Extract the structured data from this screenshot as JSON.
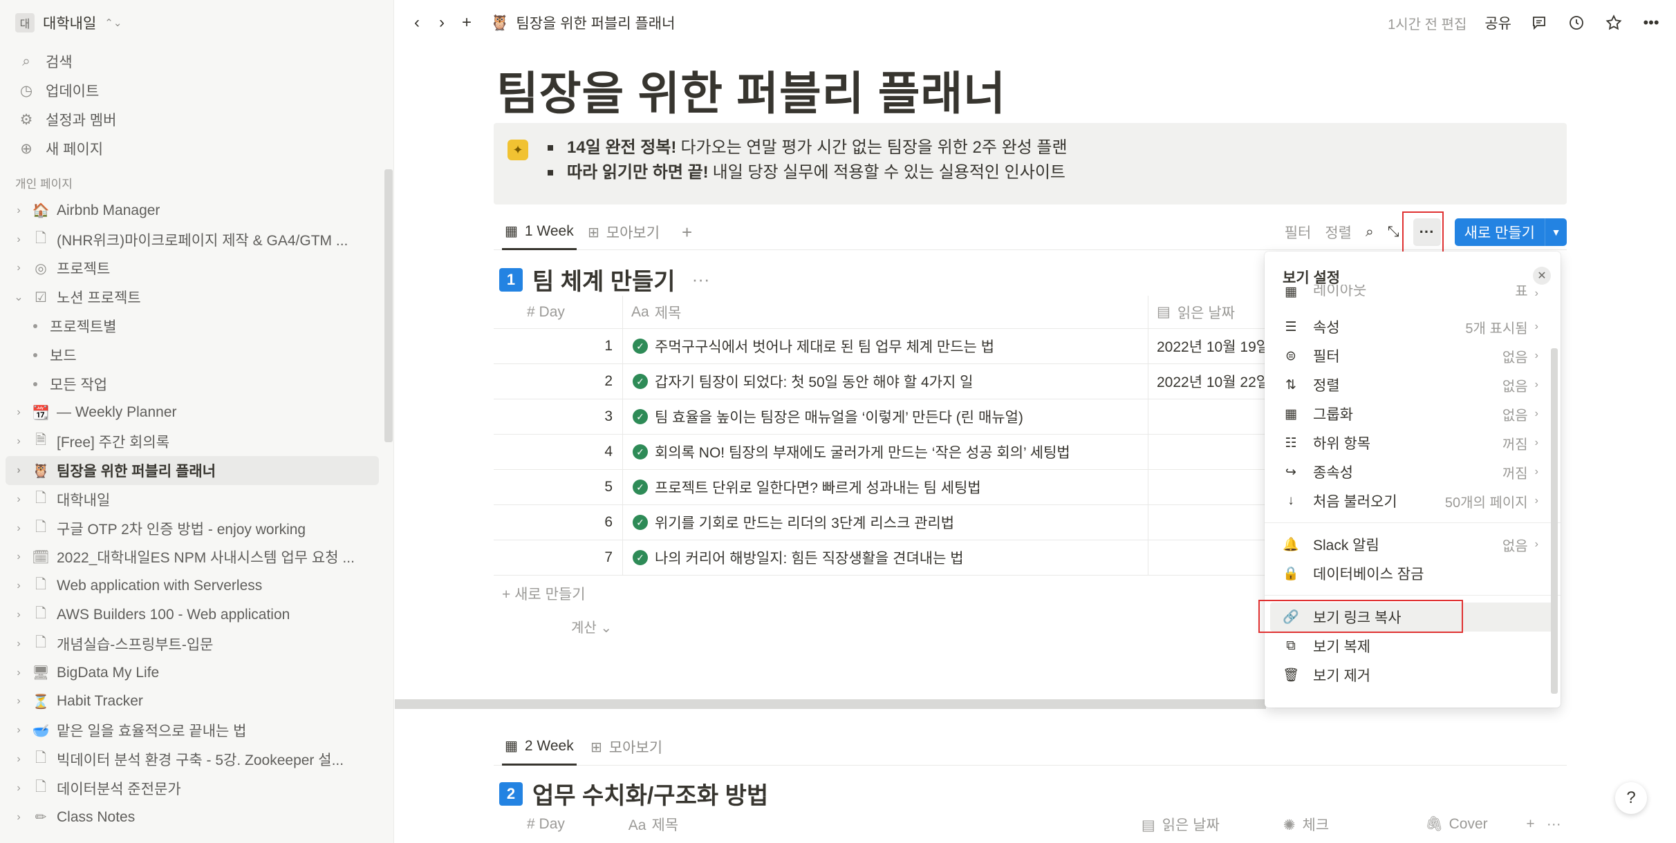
{
  "sidebar": {
    "workspace": {
      "badge": "대",
      "name": "대학내일"
    },
    "top_items": [
      {
        "icon": "search-icon",
        "glyph": "⌕",
        "label": "검색"
      },
      {
        "icon": "clock-icon",
        "glyph": "◷",
        "label": "업데이트"
      },
      {
        "icon": "gear-icon",
        "glyph": "⚙",
        "label": "설정과 멤버"
      },
      {
        "icon": "plus-circle-icon",
        "glyph": "⊕",
        "label": "새 페이지"
      }
    ],
    "section_label": "개인 페이지",
    "tree": [
      {
        "label": "Airbnb Manager",
        "icon": "house-icon",
        "glyph": "🏠"
      },
      {
        "label": "(NHR위크)마이크로페이지 제작 & GA4/GTM ...",
        "icon": "page-icon",
        "glyph": "🗋"
      },
      {
        "label": "프로젝트",
        "icon": "target-icon",
        "glyph": "◎"
      },
      {
        "label": "노션 프로젝트",
        "icon": "checkbox-icon",
        "glyph": "☑"
      },
      {
        "label": "프로젝트별",
        "sub": true
      },
      {
        "label": "보드",
        "sub": true
      },
      {
        "label": "모든 작업",
        "sub": true
      },
      {
        "label": "— Weekly Planner",
        "icon": "calendar-icon",
        "glyph": "📆"
      },
      {
        "label": "[Free] 주간 회의록",
        "icon": "doc-icon",
        "glyph": "🗎"
      },
      {
        "label": "팀장을 위한 퍼블리 플래너",
        "icon": "owl-icon",
        "glyph": "🦉",
        "active": true
      },
      {
        "label": "대학내일",
        "icon": "page-icon",
        "glyph": "🗋"
      },
      {
        "label": "구글 OTP 2차 인증 방법 - enjoy working",
        "icon": "page-icon",
        "glyph": "🗋"
      },
      {
        "label": "2022_대학내일ES NPM 사내시스템 업무 요청 ...",
        "icon": "calendar-icon",
        "glyph": "🗓"
      },
      {
        "label": "Web application with Serverless",
        "icon": "page-icon",
        "glyph": "🗋"
      },
      {
        "label": "AWS Builders 100 - Web application",
        "icon": "page-icon",
        "glyph": "🗋"
      },
      {
        "label": "개념실습-스프링부트-입문",
        "icon": "page-icon",
        "glyph": "🗋"
      },
      {
        "label": "BigData My Life",
        "icon": "monitor-icon",
        "glyph": "🖥"
      },
      {
        "label": "Habit Tracker",
        "icon": "hourglass-icon",
        "glyph": "⏳"
      },
      {
        "label": "맡은 일을 효율적으로 끝내는 법",
        "icon": "bowl-icon",
        "glyph": "🥣"
      },
      {
        "label": "빅데이터 분석 환경 구축 - 5강. Zookeeper 설...",
        "icon": "page-icon",
        "glyph": "🗋"
      },
      {
        "label": "데이터분석 준전문가",
        "icon": "page-icon",
        "glyph": "🗋"
      },
      {
        "label": "Class Notes",
        "icon": "pencil-icon",
        "glyph": "✏"
      }
    ]
  },
  "topbar": {
    "breadcrumb": "팀장을 위한 퍼블리 플래너",
    "edited": "1시간 전 편집",
    "share": "공유"
  },
  "page": {
    "title": "팀장을 위한 퍼블리 플래너",
    "callout": [
      {
        "bold": "14일 완전 정복!",
        "text": "다가오는 연말 평가 시간 없는 팀장을 위한 2주 완성 플랜"
      },
      {
        "bold": "따라 읽기만 하면 끝!",
        "text": "내일 당장 실무에 적용할 수 있는 실용적인 인사이트"
      }
    ]
  },
  "view1": {
    "tab_active": "1 Week",
    "tab_other": "모아보기",
    "tools": {
      "filter": "필터",
      "sort": "정렬"
    },
    "new_button": "새로 만들기",
    "section_number": "1",
    "section_title": "팀 체계 만들기",
    "columns": {
      "day": "Day",
      "title": "제목",
      "date": "읽은 날짜"
    },
    "rows": [
      {
        "day": "1",
        "title": "주먹구구식에서 벗어나 제대로 된 팀 업무 체계 만드는 법",
        "date": "2022년 10월 19일"
      },
      {
        "day": "2",
        "title": "갑자기 팀장이 되었다: 첫 50일 동안 해야 할 4가지 일",
        "date": "2022년 10월 22일"
      },
      {
        "day": "3",
        "title": "팀 효율을 높이는 팀장은 매뉴얼을 ‘이렇게’ 만든다 (린 매뉴얼)",
        "date": ""
      },
      {
        "day": "4",
        "title": "회의록 NO! 팀장의 부재에도 굴러가게 만드는 ‘작은 성공 회의’ 세팅법",
        "date": ""
      },
      {
        "day": "5",
        "title": "프로젝트 단위로 일한다면? 빠르게 성과내는 팀 세팅법",
        "date": ""
      },
      {
        "day": "6",
        "title": "위기를 기회로 만드는 리더의 3단계 리스크 관리법",
        "date": ""
      },
      {
        "day": "7",
        "title": "나의 커리어 해방일지: 힘든 직장생활을 견뎌내는 법",
        "date": ""
      }
    ],
    "add_row": "+ 새로 만들기",
    "calc": "계산 ⌄"
  },
  "view2": {
    "tab_active": "2 Week",
    "tab_other": "모아보기",
    "section_number": "2",
    "section_title": "업무 수치화/구조화 방법",
    "columns": {
      "day": "Day",
      "title": "제목",
      "date": "읽은 날짜",
      "check": "체크",
      "cover": "Cover"
    }
  },
  "popover": {
    "title": "보기 설정",
    "partial_label": "레이아웃",
    "partial_value": "표",
    "group1": [
      {
        "icon": "list-icon",
        "glyph": "☰",
        "label": "속성",
        "value": "5개 표시됨"
      },
      {
        "icon": "filter-icon",
        "glyph": "⊜",
        "label": "필터",
        "value": "없음"
      },
      {
        "icon": "sort-icon",
        "glyph": "⇅",
        "label": "정렬",
        "value": "없음"
      },
      {
        "icon": "group-icon",
        "glyph": "▦",
        "label": "그룹화",
        "value": "없음"
      },
      {
        "icon": "sub-items-icon",
        "glyph": "☷",
        "label": "하위 항목",
        "value": "꺼짐"
      },
      {
        "icon": "dependency-icon",
        "glyph": "↪",
        "label": "종속성",
        "value": "꺼짐"
      },
      {
        "icon": "load-icon",
        "glyph": "↓",
        "label": "처음 불러오기",
        "value": "50개의 페이지"
      }
    ],
    "group2": [
      {
        "icon": "bell-icon",
        "glyph": "🔔",
        "label": "Slack 알림",
        "value": "없음"
      },
      {
        "icon": "lock-icon",
        "glyph": "🔒",
        "label": "데이터베이스 잠금",
        "value": ""
      }
    ],
    "group3": [
      {
        "icon": "link-icon",
        "glyph": "🔗",
        "label": "보기 링크 복사"
      },
      {
        "icon": "duplicate-icon",
        "glyph": "⧉",
        "label": "보기 복제"
      },
      {
        "icon": "trash-icon",
        "glyph": "🗑",
        "label": "보기 제거"
      }
    ]
  },
  "help": "?"
}
